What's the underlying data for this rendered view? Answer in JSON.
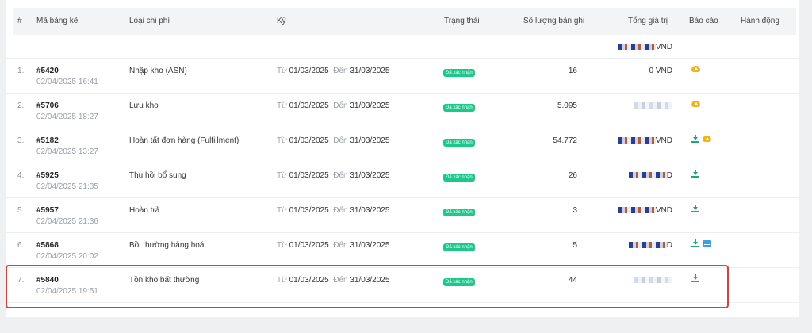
{
  "headers": {
    "index": "#",
    "code": "Mã bảng kê",
    "type": "Loại chi phí",
    "period": "Kỳ",
    "status": "Trạng thái",
    "count": "Số lượng bản ghi",
    "total": "Tổng giá trị",
    "report": "Báo cáo",
    "actions": "Hành động"
  },
  "summary": {
    "total_suffix": "VND"
  },
  "period_labels": {
    "from": "Từ",
    "to": "Đến"
  },
  "rows": [
    {
      "index": "1.",
      "code": "#5420",
      "date": "02/04/2025 16:41",
      "type": "Nhập kho (ASN)",
      "from": "01/03/2025",
      "to": "31/03/2025",
      "status": "Đã xác nhận",
      "count": "16",
      "total": "0 VND",
      "icons": [
        "cloud"
      ]
    },
    {
      "index": "2.",
      "code": "#5706",
      "date": "02/04/2025 18:27",
      "type": "Lưu kho",
      "from": "01/03/2025",
      "to": "31/03/2025",
      "status": "Đã xác nhận",
      "count": "5.095",
      "total": "",
      "icons": [
        "cloud"
      ]
    },
    {
      "index": "3.",
      "code": "#5182",
      "date": "02/04/2025 13:27",
      "type": "Hoàn tất đơn hàng (Fulfillment)",
      "from": "01/03/2025",
      "to": "31/03/2025",
      "status": "Đã xác nhận",
      "count": "54.772",
      "total": "VND",
      "icons": [
        "download",
        "cloud"
      ]
    },
    {
      "index": "4.",
      "code": "#5925",
      "date": "02/04/2025 21:35",
      "type": "Thu hồi bổ sung",
      "from": "01/03/2025",
      "to": "31/03/2025",
      "status": "Đã xác nhận",
      "count": "26",
      "total": "D",
      "icons": [
        "download"
      ]
    },
    {
      "index": "5.",
      "code": "#5957",
      "date": "02/04/2025 21:36",
      "type": "Hoàn trả",
      "from": "01/03/2025",
      "to": "31/03/2025",
      "status": "Đã xác nhận",
      "count": "3",
      "total": "VND",
      "icons": [
        "download"
      ]
    },
    {
      "index": "6.",
      "code": "#5868",
      "date": "02/04/2025 20:02",
      "type": "Bồi thường hàng hoá",
      "from": "01/03/2025",
      "to": "31/03/2025",
      "status": "Đã xác nhận",
      "count": "5",
      "total": "D",
      "icons": [
        "download",
        "document"
      ]
    },
    {
      "index": "7.",
      "code": "#5840",
      "date": "02/04/2025 19:51",
      "type": "Tồn kho bất thường",
      "from": "01/03/2025",
      "to": "31/03/2025",
      "status": "Đã xác nhận",
      "count": "44",
      "total": "",
      "icons": [
        "download"
      ]
    }
  ],
  "colors": {
    "badge": "#1cc88a",
    "download": "#1fa67a",
    "cloud": "#f1b21f",
    "highlight": "#e53935"
  }
}
